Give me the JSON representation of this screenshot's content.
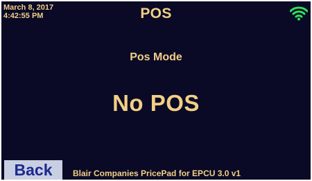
{
  "header": {
    "date": "March 8, 2017",
    "time": "4:42:55 PM",
    "title": "POS",
    "wifi_icon": "wifi-icon"
  },
  "main": {
    "mode_label": "Pos Mode",
    "mode_value": "No POS"
  },
  "footer": {
    "back_label": "Back",
    "product_text": "Blair Companies PricePad for EPCU 3.0 v1"
  },
  "colors": {
    "background": "#0a0a26",
    "text": "#f2cf86",
    "wifi": "#2ee05a",
    "back_button_bg": "#c9cfe2",
    "back_button_text": "#1c2a8e"
  }
}
